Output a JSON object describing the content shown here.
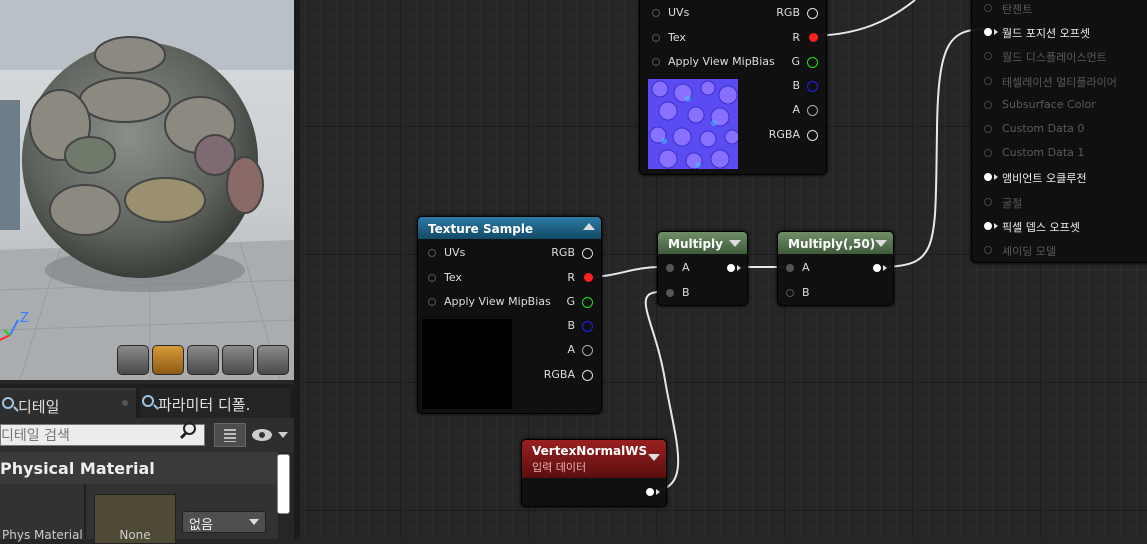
{
  "viewport": {
    "axis_z": "Z",
    "toolbar": [
      "cylinder-shape-button",
      "sphere-shape-button",
      "plane-shape-button",
      "cube-shape-button",
      "teapot-shape-button"
    ]
  },
  "details_panel": {
    "tabs": [
      {
        "label": "디테일",
        "active": true
      },
      {
        "label": "파라미터 디폴.",
        "active": false
      }
    ],
    "search_placeholder": "디테일 검색",
    "category_title": "Physical Material",
    "property_label": "Phys Material",
    "thumbnail_label": "None",
    "combo_value": "없음"
  },
  "nodes": {
    "top_texture": {
      "inputs": [
        "UVs",
        "Tex",
        "Apply View MipBias"
      ],
      "outputs": [
        "RGB",
        "R",
        "G",
        "B",
        "A",
        "RGBA"
      ]
    },
    "texture_sample": {
      "title": "Texture Sample",
      "inputs": [
        "UVs",
        "Tex",
        "Apply View MipBias"
      ],
      "outputs": [
        "RGB",
        "R",
        "G",
        "B",
        "A",
        "RGBA"
      ]
    },
    "multiply1": {
      "title": "Multiply",
      "inputs": [
        "A",
        "B"
      ]
    },
    "multiply2": {
      "title": "Multiply(,50)",
      "inputs": [
        "A",
        "B"
      ]
    },
    "vertex_normal": {
      "title": "VertexNormalWS",
      "subtitle": "입력 데이터"
    },
    "result": {
      "pins": [
        {
          "label": "탄젠트",
          "active": false
        },
        {
          "label": "월드 포지션 오프셋",
          "active": true
        },
        {
          "label": "월드 디스플레이스먼트",
          "active": false
        },
        {
          "label": "테셀레이션 멀티플라이어",
          "active": false
        },
        {
          "label": "Subsurface Color",
          "active": false
        },
        {
          "label": "Custom Data 0",
          "active": false
        },
        {
          "label": "Custom Data 1",
          "active": false
        },
        {
          "label": "앰비언트 오클루전",
          "active": true
        },
        {
          "label": "굴절",
          "active": false
        },
        {
          "label": "픽셀 뎁스 오프셋",
          "active": true
        },
        {
          "label": "셰이딩 모델",
          "active": false
        }
      ]
    }
  },
  "colors": {
    "texture_header": "#1f6389",
    "math_header": "#56744f",
    "vertex_header": "#8b1d1d",
    "pin_red": "#ff2020",
    "pin_green": "#20e020",
    "pin_blue": "#2020ff"
  }
}
